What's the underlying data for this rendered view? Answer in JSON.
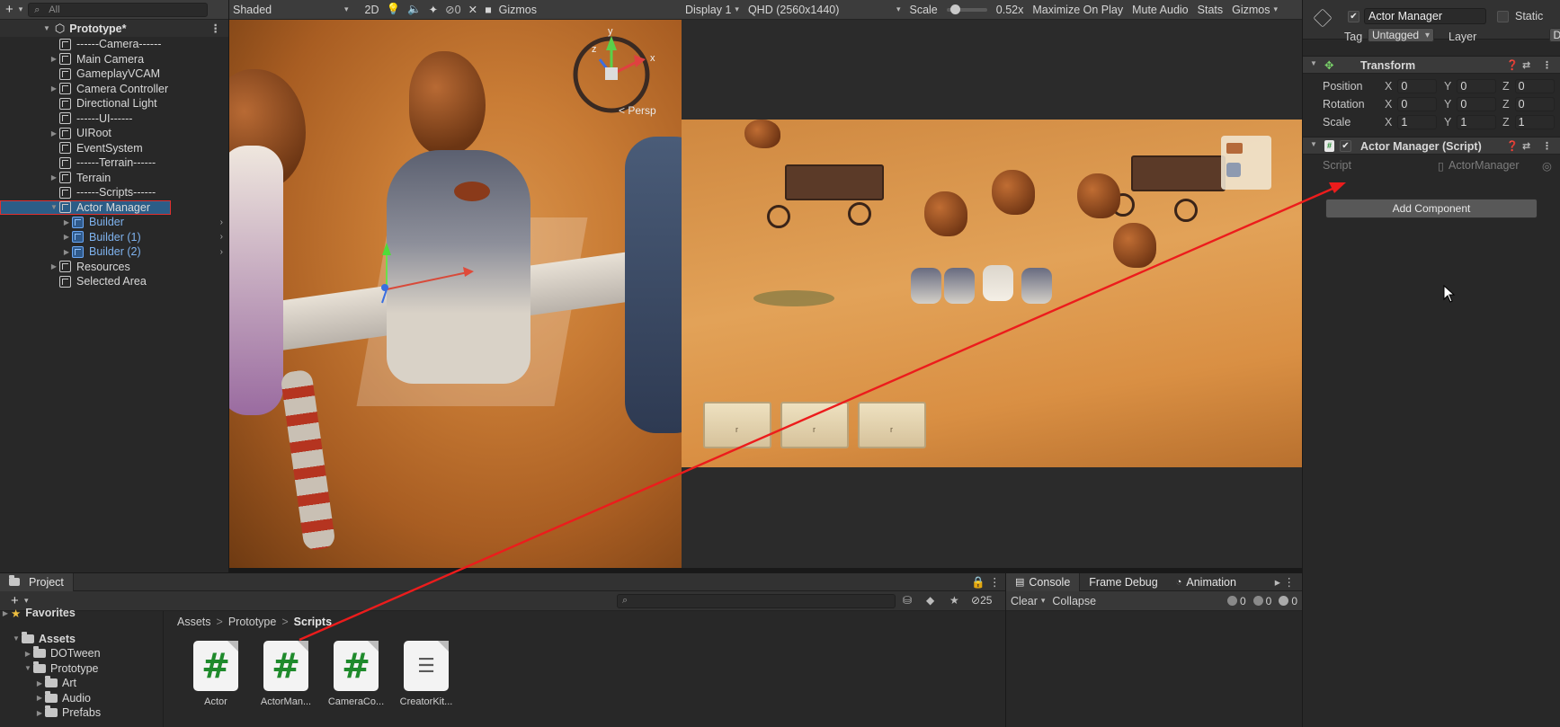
{
  "hierarchy": {
    "search_placeholder": "All",
    "scene_name": "Prototype*",
    "items": [
      {
        "label": "------Camera------",
        "indent": 1,
        "expand": false,
        "blue": false
      },
      {
        "label": "Main Camera",
        "indent": 1,
        "expand": true,
        "blue": false
      },
      {
        "label": "GameplayVCAM",
        "indent": 1,
        "expand": false,
        "blue": false
      },
      {
        "label": "Camera Controller",
        "indent": 1,
        "expand": true,
        "blue": false
      },
      {
        "label": "Directional Light",
        "indent": 1,
        "expand": false,
        "blue": false
      },
      {
        "label": "------UI------",
        "indent": 1,
        "expand": false,
        "blue": false
      },
      {
        "label": "UIRoot",
        "indent": 1,
        "expand": true,
        "blue": false
      },
      {
        "label": "EventSystem",
        "indent": 1,
        "expand": false,
        "blue": false
      },
      {
        "label": "------Terrain------",
        "indent": 1,
        "expand": false,
        "blue": false
      },
      {
        "label": "Terrain",
        "indent": 1,
        "expand": true,
        "blue": false
      },
      {
        "label": "------Scripts------",
        "indent": 1,
        "expand": false,
        "blue": false
      },
      {
        "label": "Actor Manager",
        "indent": 1,
        "expand": true,
        "blue": false,
        "selected": true
      },
      {
        "label": "Builder",
        "indent": 2,
        "expand": true,
        "blue": true
      },
      {
        "label": "Builder (1)",
        "indent": 2,
        "expand": true,
        "blue": true
      },
      {
        "label": "Builder (2)",
        "indent": 2,
        "expand": true,
        "blue": true
      },
      {
        "label": "Resources",
        "indent": 1,
        "expand": true,
        "blue": false
      },
      {
        "label": "Selected Area",
        "indent": 1,
        "expand": false,
        "blue": false
      }
    ]
  },
  "scene_toolbar": {
    "shading": "Shaded",
    "mode_2d": "2D",
    "hidden_count": "0",
    "gizmos": "Gizmos",
    "persp_label": "< Persp"
  },
  "gizmo_axes": {
    "y": "y",
    "z": "z",
    "x": "x"
  },
  "game_toolbar": {
    "display": "Display 1",
    "resolution": "QHD (2560x1440)",
    "scale_label": "Scale",
    "scale_value": "0.52x",
    "scale_fraction": 0.12,
    "maximize": "Maximize On Play",
    "mute": "Mute Audio",
    "stats": "Stats",
    "gizmos": "Gizmos"
  },
  "inspector": {
    "object_name": "Actor Manager",
    "static_label": "Static",
    "tag_label": "Tag",
    "tag_value": "Untagged",
    "layer_label": "Layer",
    "layer_value": "Default",
    "transform_title": "Transform",
    "position_label": "Position",
    "rotation_label": "Rotation",
    "scale_label": "Scale",
    "axis_x": "X",
    "axis_y": "Y",
    "axis_z": "Z",
    "position": {
      "x": "0",
      "y": "0",
      "z": "0"
    },
    "rotation": {
      "x": "0",
      "y": "0",
      "z": "0"
    },
    "scale": {
      "x": "1",
      "y": "1",
      "z": "1"
    },
    "script_component_title": "Actor Manager (Script)",
    "script_label": "Script",
    "script_value": "ActorManager",
    "add_component": "Add Component"
  },
  "project": {
    "tab": "Project",
    "favorites": "Favorites",
    "hidden_count": "25",
    "tree": [
      {
        "label": "Assets",
        "level": 0,
        "bold": true
      },
      {
        "label": "DOTween",
        "level": 1
      },
      {
        "label": "Prototype",
        "level": 1
      },
      {
        "label": "Art",
        "level": 2
      },
      {
        "label": "Audio",
        "level": 2
      },
      {
        "label": "Prefabs",
        "level": 2
      }
    ],
    "breadcrumb": [
      "Assets",
      "Prototype",
      "Scripts"
    ],
    "files": [
      {
        "name": "Actor",
        "kind": "cs"
      },
      {
        "name": "ActorMan...",
        "kind": "cs"
      },
      {
        "name": "CameraCo...",
        "kind": "cs"
      },
      {
        "name": "CreatorKit...",
        "kind": "txt"
      }
    ]
  },
  "console": {
    "tabs": [
      "Console",
      "Frame Debug",
      "Animation"
    ],
    "clear": "Clear",
    "collapse": "Collapse",
    "counts": {
      "info": "0",
      "warn": "0",
      "error": "0"
    }
  },
  "colors": {
    "selection_outline": "#e03030",
    "annotation_arrow": "#ec1c1c",
    "prefab_blue": "#7fb3ef",
    "script_hash": "#1f8a2c"
  }
}
